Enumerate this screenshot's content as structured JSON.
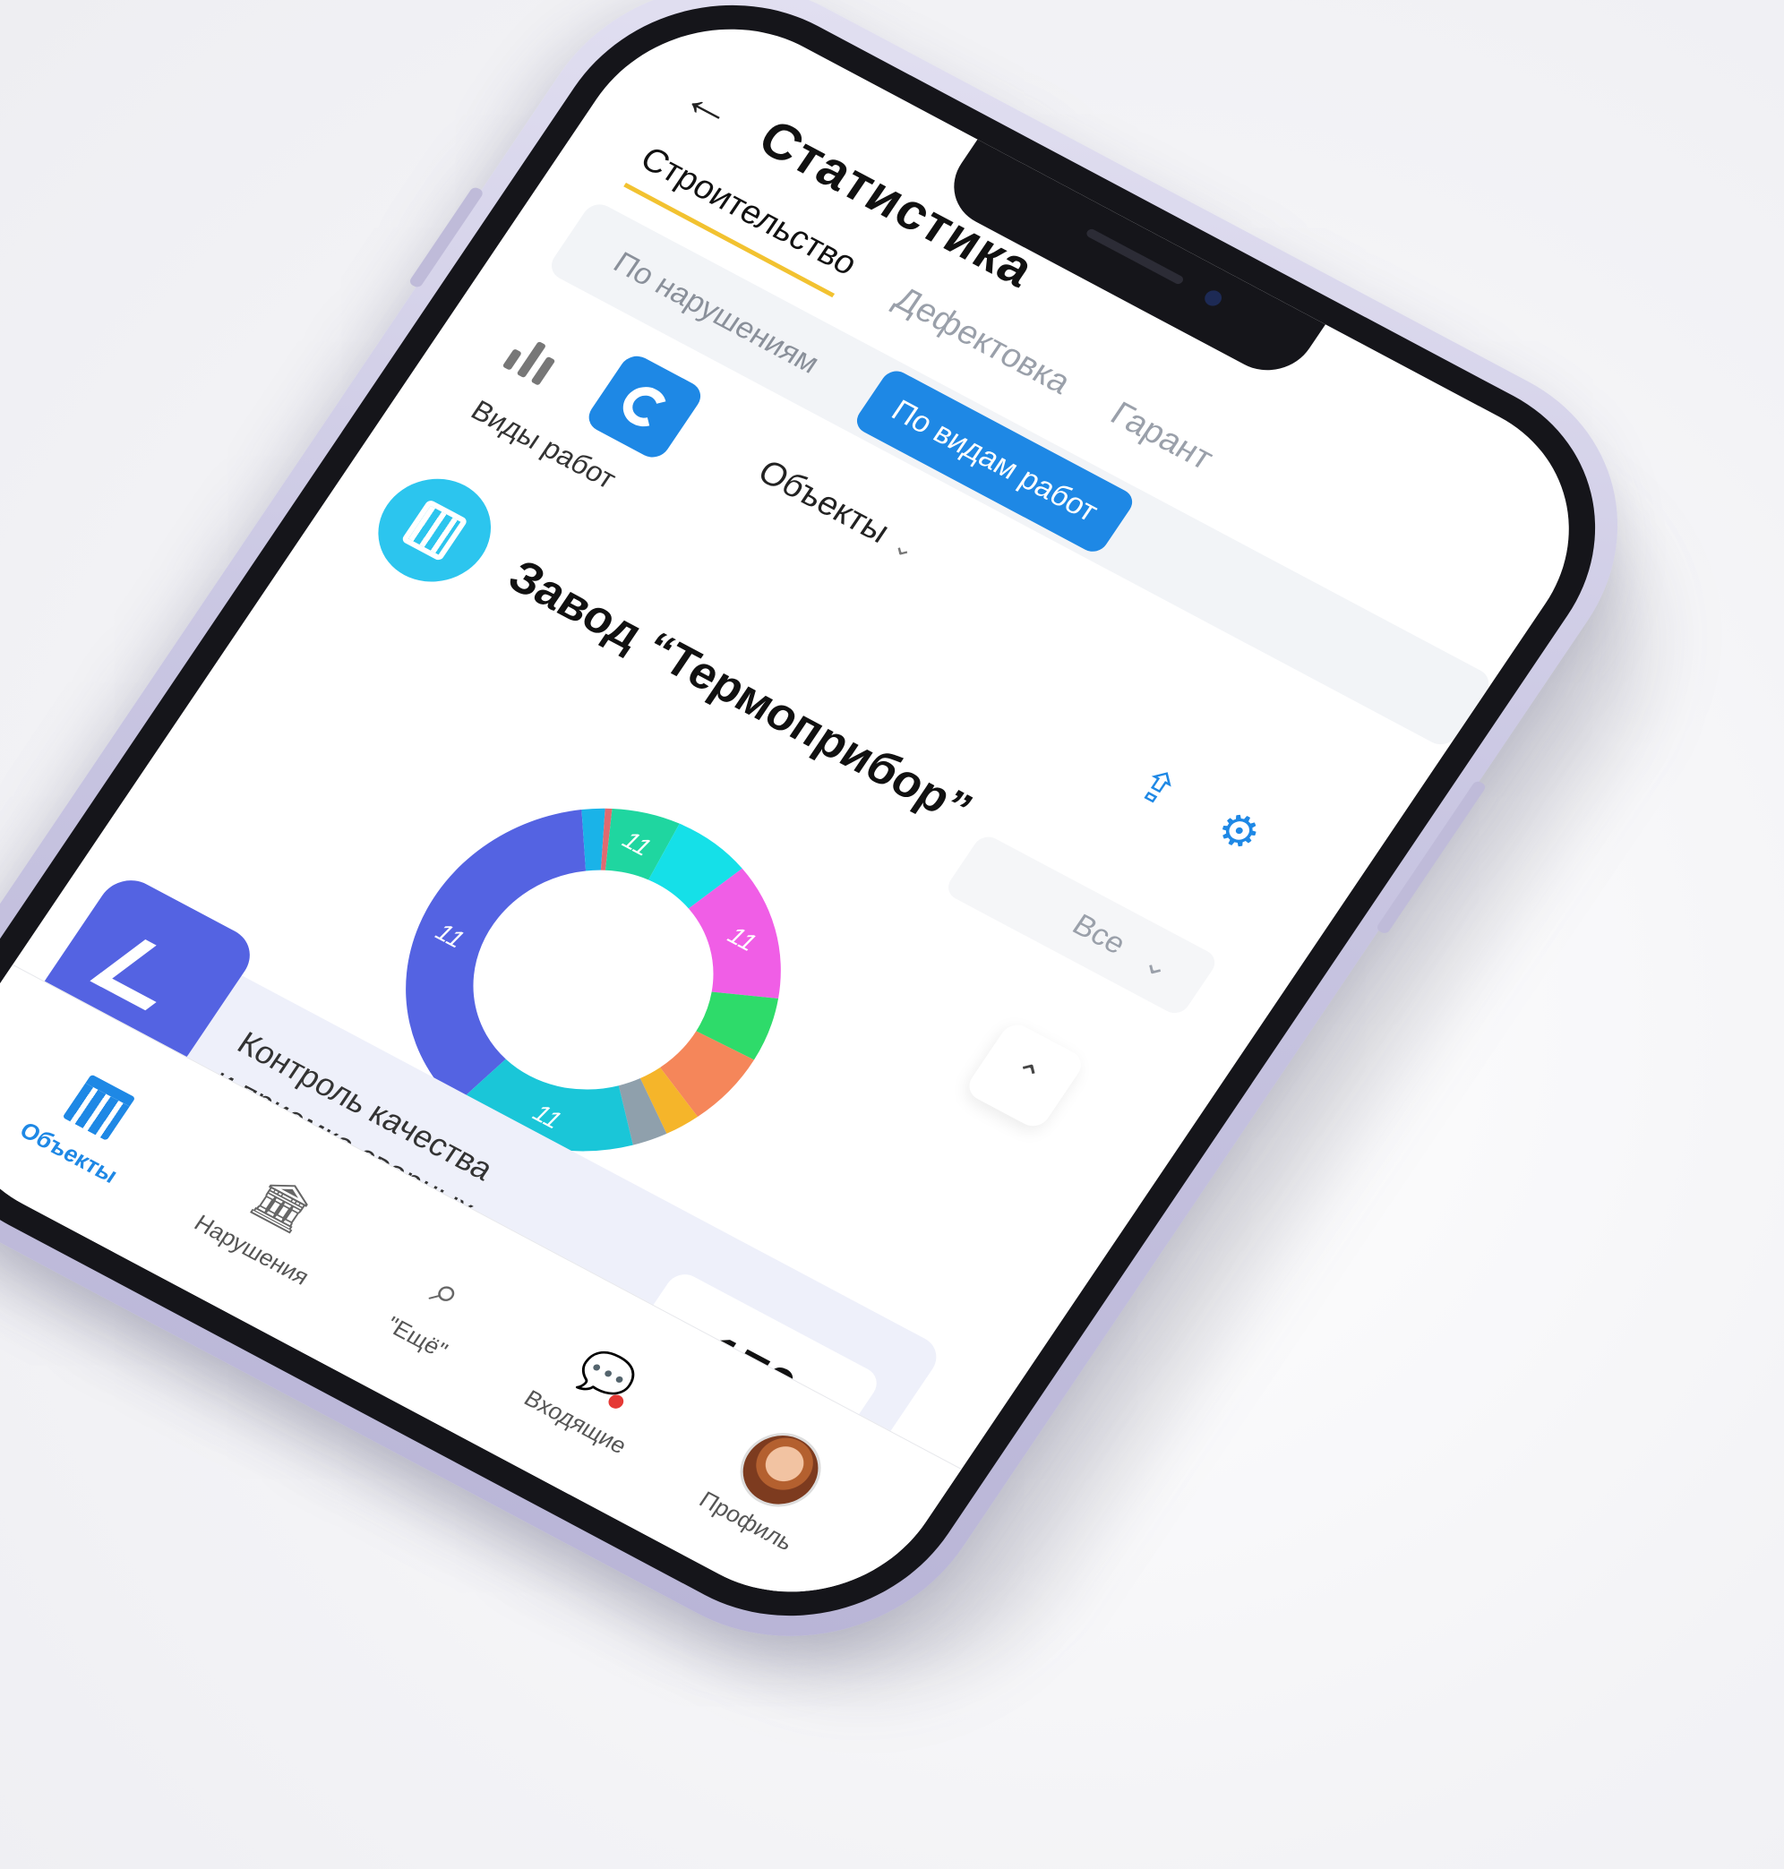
{
  "header": {
    "title": "Статистика"
  },
  "category_tabs": [
    {
      "label": "Строительство",
      "active": true
    },
    {
      "label": "Дефектовка",
      "active": false
    },
    {
      "label": "Гарант",
      "active": false
    }
  ],
  "sub_tabs": [
    {
      "label": "По нарушениям",
      "active": false
    },
    {
      "label": "По видам работ",
      "active": true
    }
  ],
  "view_switch": {
    "bar_icon": "bar-chart-icon",
    "donut_icon": "donut-chart-icon",
    "active": "donut"
  },
  "objects_select": {
    "label": "Объекты"
  },
  "group_label": "Виды работ",
  "object": {
    "name": "Завод “Термоприбор”",
    "icon": "building-icon"
  },
  "filter": {
    "value": "Все"
  },
  "colors": {
    "accent": "#1e88e5",
    "tab_underline": "#f2c230",
    "work_icon_bg": "#5463e2",
    "object_icon_bg": "#2cc5ee"
  },
  "chart_data": {
    "type": "pie",
    "labels_visible": [
      "11",
      "11",
      "11",
      "11"
    ],
    "slices": [
      {
        "color": "#5463e2",
        "value": 36,
        "label": "11"
      },
      {
        "color": "#1ab3e8",
        "value": 2,
        "label": ""
      },
      {
        "color": "#e06a70",
        "value": 0.6,
        "label": ""
      },
      {
        "color": "#1fd6a0",
        "value": 6,
        "label": "11"
      },
      {
        "color": "#15e0e8",
        "value": 7,
        "label": ""
      },
      {
        "color": "#f05ee6",
        "value": 13,
        "label": "11"
      },
      {
        "color": "#2edb6a",
        "value": 6,
        "label": ""
      },
      {
        "color": "#f5865a",
        "value": 7,
        "label": ""
      },
      {
        "color": "#f5b52a",
        "value": 3,
        "label": ""
      },
      {
        "color": "#8fa0ac",
        "value": 3,
        "label": ""
      },
      {
        "color": "#1ac6d8",
        "value": 16.4,
        "label": "11"
      }
    ]
  },
  "work_item": {
    "text_line1": "Контроль качества",
    "text_line2": "и приемка сварных..",
    "count": "170",
    "icon": "trowel-icon"
  },
  "bottom_nav": [
    {
      "label": "Объекты",
      "icon": "building-icon",
      "active": true
    },
    {
      "label": "Нарушения",
      "icon": "columns-icon",
      "active": false
    },
    {
      "label": "\"Ещё\"",
      "icon": "search-icon",
      "active": false
    },
    {
      "label": "Входящие",
      "icon": "chat-icon",
      "active": false,
      "badge": true
    },
    {
      "label": "Профиль",
      "icon": "avatar",
      "active": false
    }
  ]
}
